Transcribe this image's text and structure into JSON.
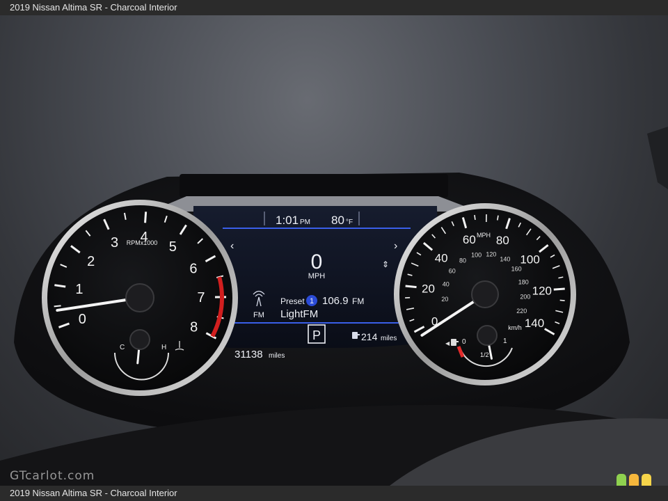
{
  "caption": "2019 Nissan Altima SR - Charcoal Interior",
  "watermark": "GTcarlot.com",
  "logo_colors": [
    "#8fd14f",
    "#f6b73c",
    "#f6d44a"
  ],
  "cluster": {
    "time": "1:01",
    "time_suffix": "PM",
    "outside_temp": "80",
    "temp_unit": "°F",
    "speed_value": "0",
    "speed_unit": "MPH",
    "radio_band": "FM",
    "preset_label": "Preset",
    "preset_number": "1",
    "frequency": "106.9",
    "frequency_unit": "FM",
    "station_name": "LightFM",
    "odometer_value": "31138",
    "odometer_unit": "miles",
    "gear": "P",
    "range_value": "214",
    "range_unit": "miles",
    "nav_left": "‹",
    "nav_right": "›",
    "nav_updown": "⇕"
  },
  "tachometer": {
    "unit_label": "RPMx1000",
    "numbers": [
      "0",
      "1",
      "2",
      "3",
      "4",
      "5",
      "6",
      "7",
      "8"
    ],
    "needle_rpm": 0.4,
    "cold_label": "C",
    "hot_label": "H",
    "temp_level": 0.45
  },
  "speedometer": {
    "unit_label": "MPH",
    "mph_numbers": [
      "0",
      "20",
      "40",
      "60",
      "80",
      "100",
      "120",
      "140"
    ],
    "kmh_label": "km/h",
    "kmh_numbers": [
      "20",
      "40",
      "60",
      "80",
      "100",
      "120",
      "140",
      "160",
      "180",
      "200",
      "220"
    ],
    "needle_mph": 0,
    "fuel_empty_label": "0",
    "fuel_half_label": "1/2",
    "fuel_full_label": "1",
    "fuel_level": 0.6
  }
}
